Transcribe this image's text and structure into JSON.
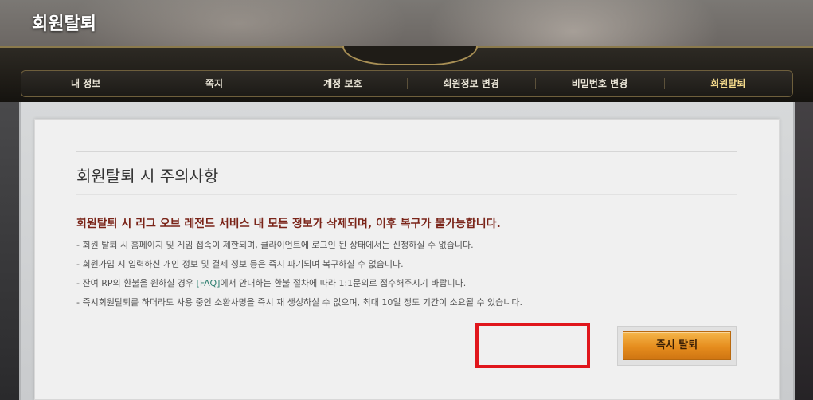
{
  "page": {
    "title": "회원탈퇴"
  },
  "nav": {
    "items": [
      {
        "label": "내 정보"
      },
      {
        "label": "쪽지"
      },
      {
        "label": "계정 보호"
      },
      {
        "label": "회원정보 변경"
      },
      {
        "label": "비밀번호 변경"
      },
      {
        "label": "회원탈퇴",
        "active": true
      }
    ]
  },
  "content": {
    "section_title": "회원탈퇴 시 주의사항",
    "warning": "회원탈퇴 시 리그 오브 레전드 서비스 내 모든 정보가 삭제되며, 이후 복구가 불가능합니다.",
    "notes": [
      "- 회원 탈퇴 시 홈페이지 및 게임 접속이 제한되며, 클라이언트에 로그인 된 상태에서는 신청하실 수 없습니다.",
      "- 회원가입 시 입력하신 개인 정보 및 결제 정보 등은 즉시 파기되며 복구하실 수 없습니다.",
      {
        "before": "- 잔여 RP의 환불을 원하실 경우 ",
        "link": "[FAQ]",
        "after": "에서 안내하는 환불 절차에 따라 1:1문의로 접수해주시기 바랍니다."
      },
      "- 즉시회원탈퇴를 하더라도 사용 중인 소환사명을 즉시 재 생성하실 수 없으며, 최대 10일 정도 기간이 소요될 수 있습니다."
    ],
    "withdraw_button": "즉시 탈퇴"
  },
  "colors": {
    "warning_text": "#7a2418",
    "faq_link": "#2b7d6e",
    "button_orange": "#e58c1d",
    "highlight_box": "#e0161c",
    "nav_active": "#f3d98b"
  }
}
